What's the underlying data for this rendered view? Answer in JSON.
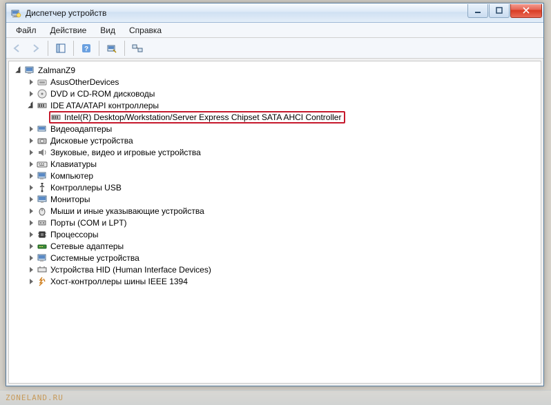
{
  "window": {
    "title": "Диспетчер устройств"
  },
  "menu": {
    "file": "Файл",
    "action": "Действие",
    "view": "Вид",
    "help": "Справка"
  },
  "tree": {
    "root": "ZalmanZ9",
    "items": [
      "AsusOtherDevices",
      "DVD и CD-ROM дисководы",
      "IDE ATA/ATAPI контроллеры",
      "Видеоадаптеры",
      "Дисковые устройства",
      "Звуковые, видео и игровые устройства",
      "Клавиатуры",
      "Компьютер",
      "Контроллеры USB",
      "Мониторы",
      "Мыши и иные указывающие устройства",
      "Порты (COM и LPT)",
      "Процессоры",
      "Сетевые адаптеры",
      "Системные устройства",
      "Устройства HID (Human Interface Devices)",
      "Хост-контроллеры шины IEEE 1394"
    ],
    "ide_child": "Intel(R) Desktop/Workstation/Server Express Chipset SATA AHCI Controller"
  },
  "watermark": "ZONELAND.RU"
}
